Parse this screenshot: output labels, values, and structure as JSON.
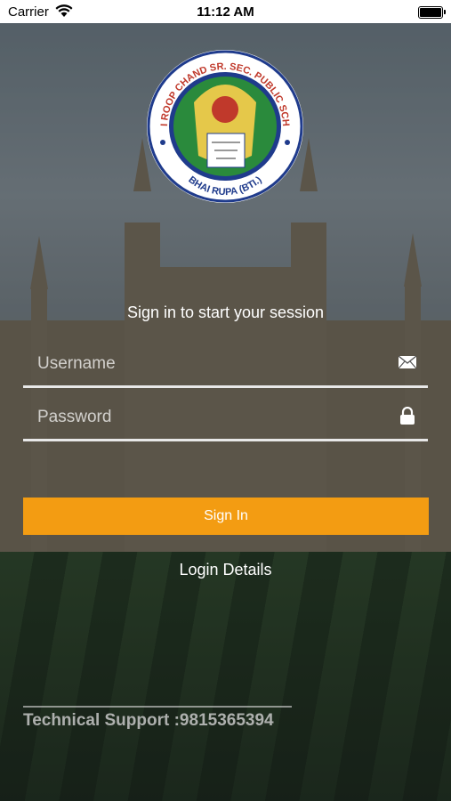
{
  "status_bar": {
    "carrier": "Carrier",
    "time": "11:12 AM"
  },
  "logo": {
    "school_name": "BHAI ROOP CHAND SR. SEC. PUBLIC SCHOOL",
    "location": "BHAI RUPA (BTI.)"
  },
  "login": {
    "subtitle": "Sign in to start your session",
    "username_placeholder": "Username",
    "password_placeholder": "Password",
    "sign_in_label": "Sign In",
    "login_details_label": "Login Details"
  },
  "footer": {
    "support_text": "Technical Support :9815365394"
  },
  "icons": {
    "username": "mail-icon",
    "password": "lock-icon"
  },
  "colors": {
    "accent": "#f39c12",
    "logo_ring": "#1f3b8c",
    "logo_inner": "#2a8a3c",
    "logo_gold": "#e5c84a"
  }
}
